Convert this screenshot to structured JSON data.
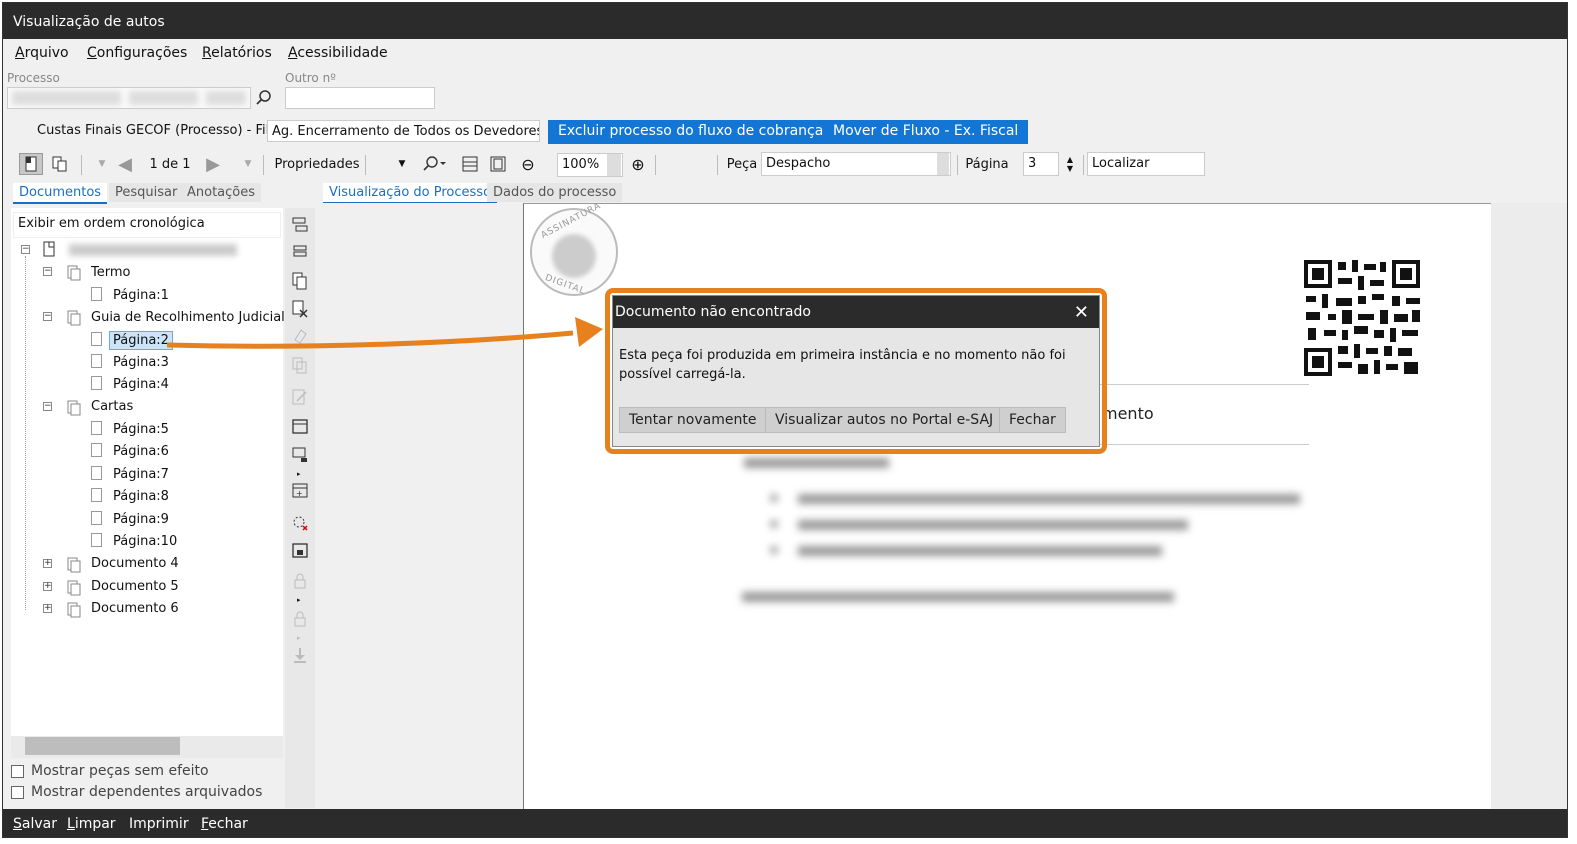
{
  "window": {
    "title": "Visualização de autos"
  },
  "menu": {
    "items": [
      "Arquivo",
      "Configurações",
      "Relatórios",
      "Acessibilidade"
    ]
  },
  "process": {
    "label_processo": "Processo",
    "label_outro": "Outro nº",
    "fila_label": "Custas Finais GECOF (Processo) - Fila:",
    "fila_value": "Ag. Encerramento de Todos os Devedores",
    "btn_excluir": "Excluir processo do fluxo de cobrança",
    "btn_mover": "Mover de Fluxo - Ex. Fiscal"
  },
  "toolbar": {
    "page_of": "1 de 1",
    "propriedades": "Propriedades",
    "zoom": "100%",
    "peca_label": "Peça",
    "peca_value": "Despacho",
    "pagina_label": "Página",
    "pagina_value": "3",
    "localizar_placeholder": "Localizar"
  },
  "left_tabs": [
    "Documentos",
    "Pesquisar",
    "Anotações"
  ],
  "view_tabs": [
    "Visualização do Processo",
    "Dados do processo"
  ],
  "order_select": "Exibir em ordem cronológica",
  "tree": {
    "groups": [
      {
        "label": "Termo",
        "pages": [
          "Página:1"
        ]
      },
      {
        "label": "Guia de Recolhimento Judicial",
        "pages": [
          "Página:2",
          "Página:3",
          "Página:4"
        ]
      },
      {
        "label": "Cartas",
        "pages": [
          "Página:5",
          "Página:6",
          "Página:7",
          "Página:8",
          "Página:9",
          "Página:10"
        ]
      }
    ],
    "collapsed": [
      "Documento 4",
      "Documento 5",
      "Documento 6"
    ]
  },
  "options": {
    "show_no_effect": "Mostrar peças sem efeito",
    "show_archived": "Mostrar dependentes arquivados"
  },
  "document": {
    "stamp_top": "ASSINATURA",
    "stamp_bottom": "DIGITAL",
    "partial_heading": "mento"
  },
  "dialog": {
    "title": "Documento não encontrado",
    "message": "Esta peça foi produzida em primeira instância e no momento não foi possível carregá-la.",
    "btn_retry": "Tentar novamente",
    "btn_portal": "Visualizar autos no Portal e-SAJ",
    "btn_close": "Fechar"
  },
  "status": {
    "items": [
      "Salvar",
      "Limpar",
      "Imprimir",
      "Fechar"
    ]
  },
  "colors": {
    "accent": "#1476d4",
    "highlight": "#e6811e",
    "dark": "#2b2b2b"
  }
}
